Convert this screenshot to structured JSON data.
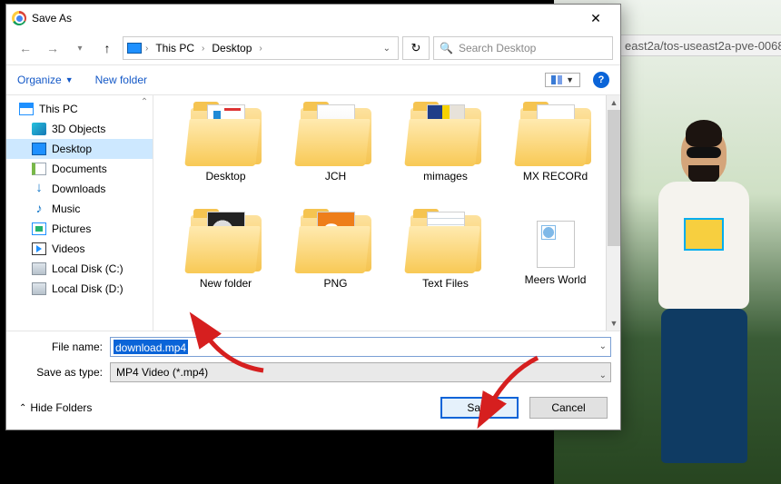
{
  "browser": {
    "url_fragment": "east2a/tos-useast2a-pve-0068"
  },
  "dialog": {
    "title": "Save As",
    "nav": {
      "back_enabled": false,
      "forward_enabled": false,
      "breadcrumb": [
        "This PC",
        "Desktop"
      ],
      "refresh_glyph": "↻"
    },
    "search": {
      "placeholder": "Search Desktop",
      "icon_glyph": "🔍"
    },
    "toolbar": {
      "organize_label": "Organize",
      "newfolder_label": "New folder",
      "help_glyph": "?"
    },
    "tree": {
      "items": [
        {
          "label": "This PC",
          "icon": "thispc",
          "selected": false
        },
        {
          "label": "3D Objects",
          "icon": "3d",
          "selected": false
        },
        {
          "label": "Desktop",
          "icon": "desktop",
          "selected": true
        },
        {
          "label": "Documents",
          "icon": "docs",
          "selected": false
        },
        {
          "label": "Downloads",
          "icon": "down",
          "selected": false
        },
        {
          "label": "Music",
          "icon": "music",
          "selected": false
        },
        {
          "label": "Pictures",
          "icon": "pics",
          "selected": false
        },
        {
          "label": "Videos",
          "icon": "vids",
          "selected": false
        },
        {
          "label": "Local Disk (C:)",
          "icon": "disk",
          "selected": false
        },
        {
          "label": "Local Disk (D:)",
          "icon": "disk",
          "selected": false
        }
      ]
    },
    "files": [
      {
        "label": "Desktop",
        "variant": "desktop"
      },
      {
        "label": "JCH",
        "variant": "jch"
      },
      {
        "label": "mimages",
        "variant": "mimages"
      },
      {
        "label": "MX RECORd",
        "variant": "mxrec"
      },
      {
        "label": "New folder",
        "variant": "newf"
      },
      {
        "label": "PNG",
        "variant": "png"
      },
      {
        "label": "Text Files",
        "variant": "textfiles"
      },
      {
        "label": "Meers World",
        "variant": "meers"
      }
    ],
    "filename": {
      "label": "File name:",
      "value": "download.mp4"
    },
    "filetype": {
      "label": "Save as type:",
      "value": "MP4 Video (*.mp4)"
    },
    "footer": {
      "hide_label": "Hide Folders",
      "save_label": "Save",
      "cancel_label": "Cancel"
    }
  }
}
